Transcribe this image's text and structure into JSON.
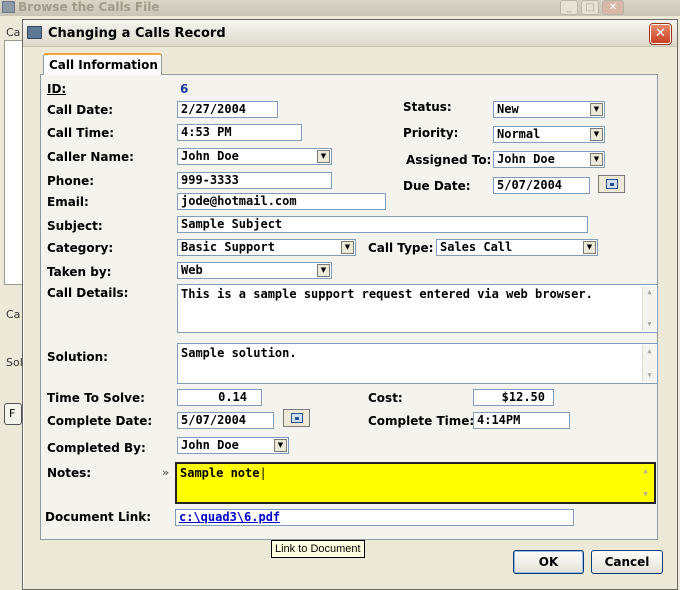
{
  "background_window": {
    "title": "Browse the Calls File",
    "label_ca1": "Ca",
    "label_ca2": "Ca",
    "label_sol": "Sol",
    "button_partial": "F"
  },
  "dialog": {
    "title": "Changing a Calls Record",
    "close_glyph": "✕",
    "tab_label": "Call Information"
  },
  "form": {
    "id_label": "ID:",
    "id_value": "6",
    "call_date": {
      "label": "Call Date:",
      "value": "2/27/2004"
    },
    "call_time": {
      "label": "Call Time:",
      "value": "4:53 PM"
    },
    "caller_name": {
      "label": "Caller Name:",
      "value": "John Doe"
    },
    "phone": {
      "label": "Phone:",
      "value": "999-3333"
    },
    "email": {
      "label": "Email:",
      "value": "jode@hotmail.com"
    },
    "subject": {
      "label": "Subject:",
      "value": "Sample Subject"
    },
    "category": {
      "label": "Category:",
      "value": "Basic Support"
    },
    "call_type": {
      "label": "Call Type:",
      "value": "Sales Call"
    },
    "taken_by": {
      "label": "Taken by:",
      "value": "Web"
    },
    "call_details": {
      "label": "Call Details:",
      "value": "This is a sample support request entered via web browser."
    },
    "solution": {
      "label": "Solution:",
      "value": "Sample solution."
    },
    "time_to_solve": {
      "label": "Time To Solve:",
      "value": "0.14"
    },
    "cost": {
      "label": "Cost:",
      "value": "$12.50"
    },
    "complete_date": {
      "label": "Complete Date:",
      "value": "5/07/2004"
    },
    "complete_time": {
      "label": "Complete Time:",
      "value": "4:14PM"
    },
    "completed_by": {
      "label": "Completed By:",
      "value": "John Doe"
    },
    "notes": {
      "label": "Notes:",
      "value": "Sample note",
      "chevrons": "»"
    },
    "document_link": {
      "label": "Document Link:",
      "value": "c:\\quad3\\6.pdf"
    },
    "status": {
      "label": "Status:",
      "value": "New"
    },
    "priority": {
      "label": "Priority:",
      "value": "Normal"
    },
    "assigned_to": {
      "label": "Assigned To:",
      "value": "John Doe"
    },
    "due_date": {
      "label": "Due Date:",
      "value": "5/07/2004"
    }
  },
  "tooltip": "Link to Document",
  "buttons": {
    "ok": "OK",
    "cancel": "Cancel"
  },
  "glyphs": {
    "dropdown": "▼",
    "scroll_up": "▲",
    "scroll_down": "▼"
  },
  "colors": {
    "notes_bg": "#ffff00",
    "titlebar_close": "#c84124",
    "id_value": "#1a3a9a"
  }
}
